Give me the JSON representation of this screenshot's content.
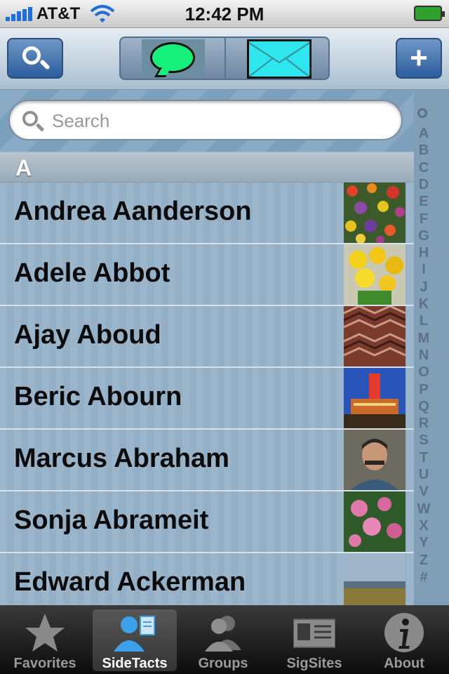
{
  "status_bar": {
    "carrier": "AT&T",
    "time": "12:42 PM"
  },
  "toolbar": {
    "search_icon": "magnifier-icon",
    "add_label": "+",
    "segments": [
      {
        "icon": "message-bubble-icon",
        "color": "#14f07a"
      },
      {
        "icon": "envelope-icon",
        "color": "#2ee6ee"
      }
    ]
  },
  "search": {
    "placeholder": "Search",
    "value": ""
  },
  "index": {
    "letters": [
      "A",
      "B",
      "C",
      "D",
      "E",
      "F",
      "G",
      "H",
      "I",
      "J",
      "K",
      "L",
      "M",
      "N",
      "O",
      "P",
      "Q",
      "R",
      "S",
      "T",
      "U",
      "V",
      "W",
      "X",
      "Y",
      "Z",
      "#"
    ]
  },
  "section": {
    "header": "A"
  },
  "contacts": [
    {
      "name": "Andrea Aanderson",
      "photo": "flowers-photo"
    },
    {
      "name": "Adele Abbot",
      "photo": "yellow-flowers-photo"
    },
    {
      "name": "Ajay Aboud",
      "photo": "rug-pattern-photo"
    },
    {
      "name": "Beric Abourn",
      "photo": "tower-night-photo"
    },
    {
      "name": "Marcus Abraham",
      "photo": "portrait-photo"
    },
    {
      "name": "Sonja Abrameit",
      "photo": "pink-flowers-photo"
    },
    {
      "name": "Edward Ackerman",
      "photo": "landscape-photo"
    }
  ],
  "tabs": [
    {
      "label": "Favorites",
      "icon": "star-icon",
      "selected": false
    },
    {
      "label": "SideTacts",
      "icon": "person-card-icon",
      "selected": true
    },
    {
      "label": "Groups",
      "icon": "group-icon",
      "selected": false
    },
    {
      "label": "SigSites",
      "icon": "id-card-icon",
      "selected": false
    },
    {
      "label": "About",
      "icon": "info-icon",
      "selected": false
    }
  ]
}
